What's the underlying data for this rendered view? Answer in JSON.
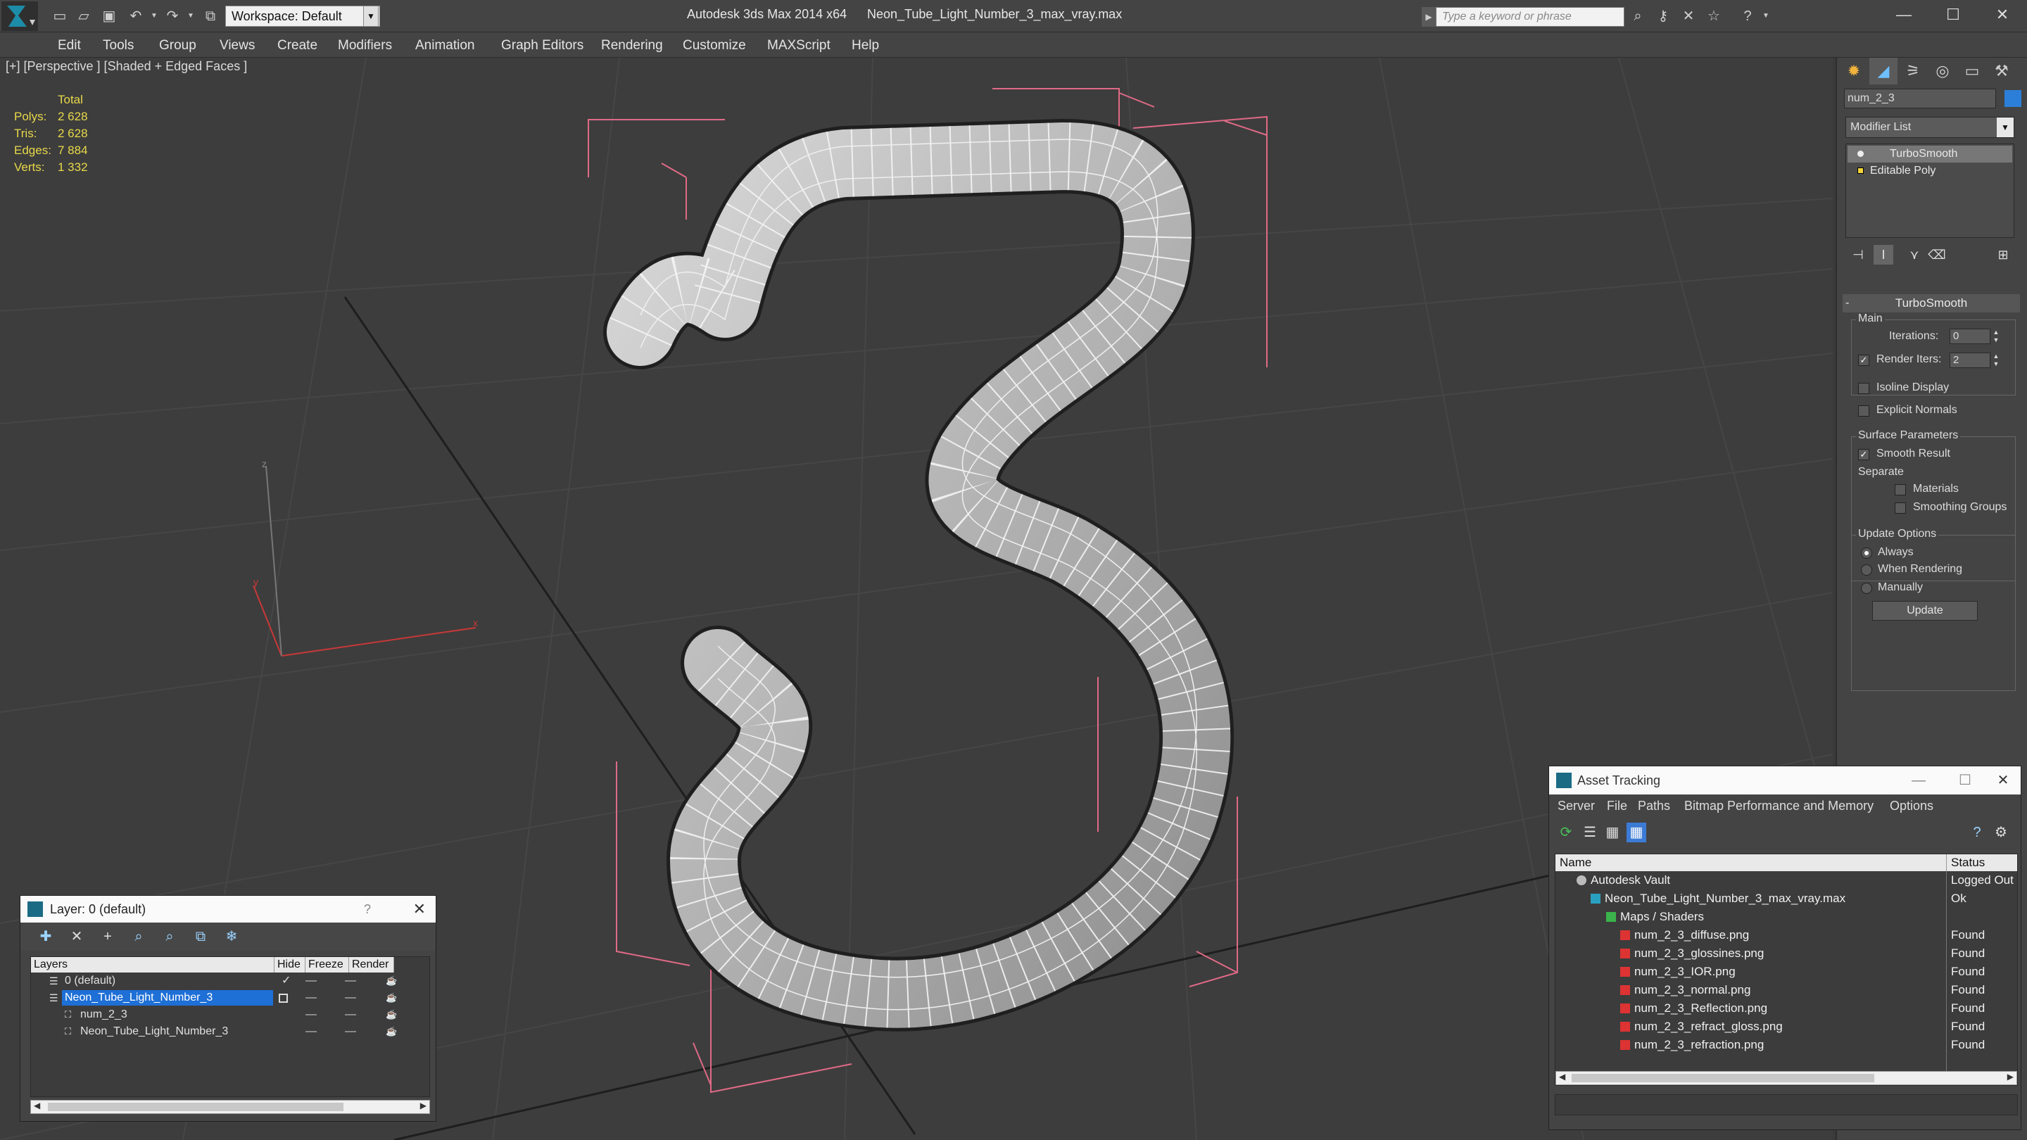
{
  "titlebar": {
    "workspace": "Workspace: Default",
    "app_title": "Autodesk 3ds Max  2014 x64",
    "file_title": "Neon_Tube_Light_Number_3_max_vray.max",
    "search_placeholder": "Type a keyword or phrase"
  },
  "menu": [
    "Edit",
    "Tools",
    "Group",
    "Views",
    "Create",
    "Modifiers",
    "Animation",
    "Graph Editors",
    "Rendering",
    "Customize",
    "MAXScript",
    "Help"
  ],
  "viewport": {
    "label": "[+] [Perspective ] [Shaded + Edged Faces ]",
    "stats_header": "Total",
    "stats": [
      {
        "key": "Polys:",
        "value": "2 628"
      },
      {
        "key": "Tris:",
        "value": "2 628"
      },
      {
        "key": "Edges:",
        "value": "7 884"
      },
      {
        "key": "Verts:",
        "value": "1 332"
      }
    ],
    "axis_labels": {
      "x": "x",
      "y": "y",
      "z": "z"
    }
  },
  "command_panel": {
    "object_name": "num_2_3",
    "object_color": "#2c7fd8",
    "modifier_list": "Modifier List",
    "stack": [
      "TurboSmooth",
      "Editable Poly"
    ],
    "rollout_title": "TurboSmooth",
    "main_group": "Main",
    "iterations_label": "Iterations:",
    "iterations_value": "0",
    "render_iters_label": "Render Iters:",
    "render_iters_value": "2",
    "isoline_label": "Isoline Display",
    "explicit_normals_label": "Explicit Normals",
    "surface_group": "Surface Parameters",
    "smooth_result_label": "Smooth Result",
    "separate_label": "Separate",
    "materials_label": "Materials",
    "smoothing_groups_label": "Smoothing Groups",
    "update_group": "Update Options",
    "always_label": "Always",
    "when_rendering_label": "When Rendering",
    "manually_label": "Manually",
    "update_button": "Update"
  },
  "layer_dialog": {
    "title": "Layer: 0 (default)",
    "help": "?",
    "columns": [
      "Layers",
      "Hide",
      "Freeze",
      "Render"
    ],
    "rows": [
      {
        "name": "0 (default)",
        "indent": 0
      },
      {
        "name": "Neon_Tube_Light_Number_3",
        "indent": 0,
        "selected": true
      },
      {
        "name": "num_2_3",
        "indent": 1
      },
      {
        "name": "Neon_Tube_Light_Number_3",
        "indent": 1
      }
    ]
  },
  "asset_dialog": {
    "title": "Asset Tracking",
    "menu": [
      "Server",
      "File",
      "Paths",
      "Bitmap Performance and Memory",
      "Options"
    ],
    "columns": [
      "Name",
      "Status"
    ],
    "rows": [
      {
        "name": "Autodesk Vault",
        "status": "Logged Out",
        "level": 0
      },
      {
        "name": "Neon_Tube_Light_Number_3_max_vray.max",
        "status": "Ok",
        "level": 1
      },
      {
        "name": "Maps / Shaders",
        "status": "",
        "level": 2
      },
      {
        "name": "num_2_3_diffuse.png",
        "status": "Found",
        "level": 3
      },
      {
        "name": "num_2_3_glossines.png",
        "status": "Found",
        "level": 3
      },
      {
        "name": "num_2_3_IOR.png",
        "status": "Found",
        "level": 3
      },
      {
        "name": "num_2_3_normal.png",
        "status": "Found",
        "level": 3
      },
      {
        "name": "num_2_3_Reflection.png",
        "status": "Found",
        "level": 3
      },
      {
        "name": "num_2_3_refract_gloss.png",
        "status": "Found",
        "level": 3
      },
      {
        "name": "num_2_3_refraction.png",
        "status": "Found",
        "level": 3
      }
    ]
  }
}
